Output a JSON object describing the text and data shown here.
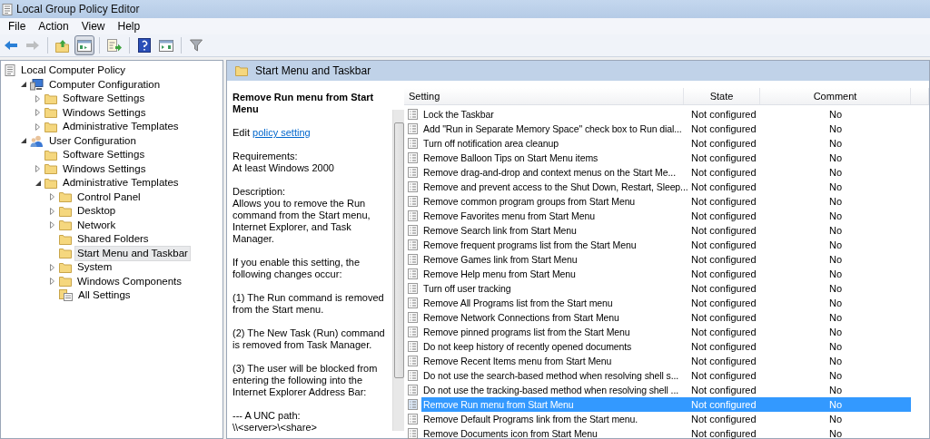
{
  "window": {
    "title": "Local Group Policy Editor"
  },
  "menu": [
    "File",
    "Action",
    "View",
    "Help"
  ],
  "toolbar": [
    {
      "kind": "back",
      "disabled": false,
      "pressed": false
    },
    {
      "kind": "forward",
      "disabled": true,
      "pressed": false
    },
    {
      "kind": "up",
      "disabled": false,
      "pressed": false
    },
    {
      "kind": "tree",
      "disabled": false,
      "pressed": true
    },
    {
      "kind": "export",
      "disabled": false,
      "pressed": false
    },
    {
      "kind": "help",
      "disabled": false,
      "pressed": false
    },
    {
      "kind": "pane",
      "disabled": false,
      "pressed": false
    },
    {
      "kind": "filter",
      "disabled": false,
      "pressed": false
    }
  ],
  "tree": [
    {
      "label": "Local Computer Policy",
      "kind": "policy",
      "selected": false,
      "children": [
        {
          "label": "Computer Configuration",
          "kind": "computer",
          "expandable": true,
          "expanded": true,
          "selected": false,
          "children": [
            {
              "label": "Software Settings",
              "kind": "folder",
              "expandable": true,
              "expanded": false,
              "selected": false
            },
            {
              "label": "Windows Settings",
              "kind": "folder",
              "expandable": true,
              "expanded": false,
              "selected": false
            },
            {
              "label": "Administrative Templates",
              "kind": "folder",
              "expandable": true,
              "expanded": false,
              "selected": false
            }
          ]
        },
        {
          "label": "User Configuration",
          "kind": "user",
          "expandable": true,
          "expanded": true,
          "selected": false,
          "children": [
            {
              "label": "Software Settings",
              "kind": "folder",
              "expandable": false,
              "selected": false
            },
            {
              "label": "Windows Settings",
              "kind": "folder",
              "expandable": true,
              "expanded": false,
              "selected": false
            },
            {
              "label": "Administrative Templates",
              "kind": "folder",
              "expandable": true,
              "expanded": true,
              "selected": false,
              "children": [
                {
                  "label": "Control Panel",
                  "kind": "folder",
                  "expandable": true,
                  "expanded": false,
                  "selected": false
                },
                {
                  "label": "Desktop",
                  "kind": "folder",
                  "expandable": true,
                  "expanded": false,
                  "selected": false
                },
                {
                  "label": "Network",
                  "kind": "folder",
                  "expandable": true,
                  "expanded": false,
                  "selected": false
                },
                {
                  "label": "Shared Folders",
                  "kind": "folder",
                  "expandable": false,
                  "selected": false
                },
                {
                  "label": "Start Menu and Taskbar",
                  "kind": "folder",
                  "expandable": false,
                  "selected": true
                },
                {
                  "label": "System",
                  "kind": "folder",
                  "expandable": true,
                  "expanded": false,
                  "selected": false
                },
                {
                  "label": "Windows Components",
                  "kind": "folder",
                  "expandable": true,
                  "expanded": false,
                  "selected": false
                },
                {
                  "label": "All Settings",
                  "kind": "settings",
                  "expandable": false,
                  "selected": false
                }
              ]
            }
          ]
        }
      ]
    }
  ],
  "header": {
    "title": "Start Menu and Taskbar"
  },
  "details": {
    "title": "Remove Run menu from Start Menu",
    "edit_prefix": "Edit",
    "edit_link": "policy setting",
    "paragraphs": [
      "Requirements:\nAt least Windows 2000",
      "Description:\nAllows you to remove the Run command from the Start menu, Internet Explorer, and Task Manager.",
      "If you enable this setting, the following changes occur:",
      "(1) The Run command is removed from the Start menu.",
      "(2) The New Task (Run) command is removed from Task Manager.",
      "(3) The user will be blocked from entering the following into the Internet Explorer Address Bar:",
      "--- A UNC path:\n\\\\<server>\\<share>"
    ]
  },
  "table": {
    "columns": [
      "Setting",
      "State",
      "Comment"
    ],
    "rows": [
      {
        "setting": "Lock the Taskbar",
        "state": "Not configured",
        "comment": "No",
        "selected": false
      },
      {
        "setting": "Add \"Run in Separate Memory Space\" check box to Run dial...",
        "state": "Not configured",
        "comment": "No",
        "selected": false
      },
      {
        "setting": "Turn off notification area cleanup",
        "state": "Not configured",
        "comment": "No",
        "selected": false
      },
      {
        "setting": "Remove Balloon Tips on Start Menu items",
        "state": "Not configured",
        "comment": "No",
        "selected": false
      },
      {
        "setting": "Remove drag-and-drop and context menus on the Start Me...",
        "state": "Not configured",
        "comment": "No",
        "selected": false
      },
      {
        "setting": "Remove and prevent access to the Shut Down, Restart, Sleep...",
        "state": "Not configured",
        "comment": "No",
        "selected": false
      },
      {
        "setting": "Remove common program groups from Start Menu",
        "state": "Not configured",
        "comment": "No",
        "selected": false
      },
      {
        "setting": "Remove Favorites menu from Start Menu",
        "state": "Not configured",
        "comment": "No",
        "selected": false
      },
      {
        "setting": "Remove Search link from Start Menu",
        "state": "Not configured",
        "comment": "No",
        "selected": false
      },
      {
        "setting": "Remove frequent programs list from the Start Menu",
        "state": "Not configured",
        "comment": "No",
        "selected": false
      },
      {
        "setting": "Remove Games link from Start Menu",
        "state": "Not configured",
        "comment": "No",
        "selected": false
      },
      {
        "setting": "Remove Help menu from Start Menu",
        "state": "Not configured",
        "comment": "No",
        "selected": false
      },
      {
        "setting": "Turn off user tracking",
        "state": "Not configured",
        "comment": "No",
        "selected": false
      },
      {
        "setting": "Remove All Programs list from the Start menu",
        "state": "Not configured",
        "comment": "No",
        "selected": false
      },
      {
        "setting": "Remove Network Connections from Start Menu",
        "state": "Not configured",
        "comment": "No",
        "selected": false
      },
      {
        "setting": "Remove pinned programs list from the Start Menu",
        "state": "Not configured",
        "comment": "No",
        "selected": false
      },
      {
        "setting": "Do not keep history of recently opened documents",
        "state": "Not configured",
        "comment": "No",
        "selected": false
      },
      {
        "setting": "Remove Recent Items menu from Start Menu",
        "state": "Not configured",
        "comment": "No",
        "selected": false
      },
      {
        "setting": "Do not use the search-based method when resolving shell s...",
        "state": "Not configured",
        "comment": "No",
        "selected": false
      },
      {
        "setting": "Do not use the tracking-based method when resolving shell ...",
        "state": "Not configured",
        "comment": "No",
        "selected": false
      },
      {
        "setting": "Remove Run menu from Start Menu",
        "state": "Not configured",
        "comment": "No",
        "selected": true
      },
      {
        "setting": "Remove Default Programs link from the Start menu.",
        "state": "Not configured",
        "comment": "No",
        "selected": false
      },
      {
        "setting": "Remove Documents icon from Start Menu",
        "state": "Not configured",
        "comment": "No",
        "selected": false
      }
    ]
  }
}
